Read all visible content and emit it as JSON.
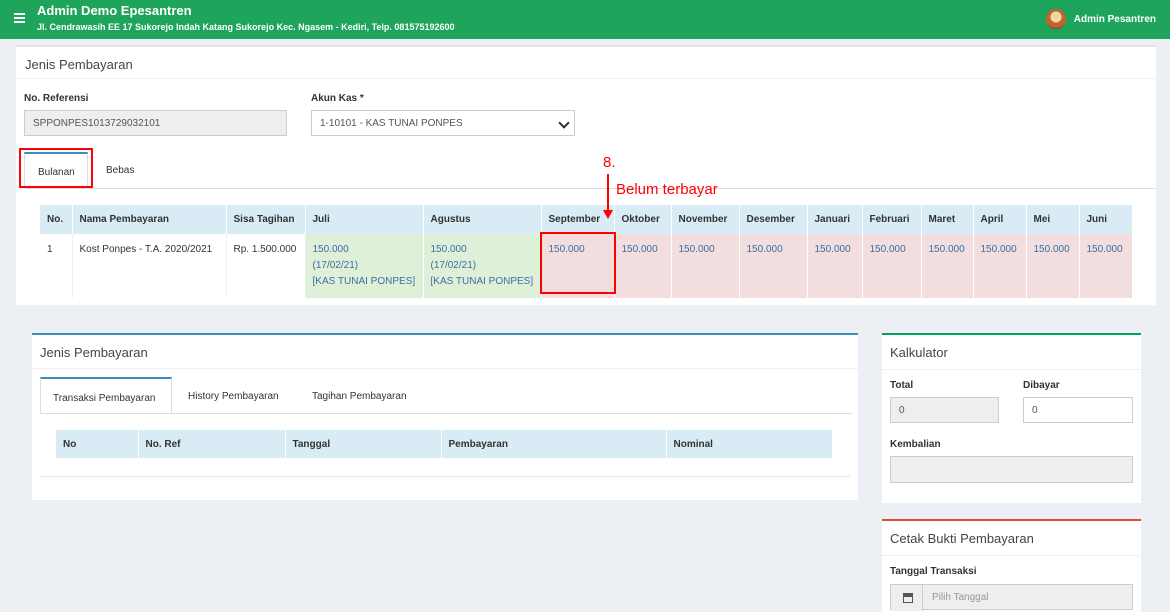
{
  "header": {
    "title": "Admin Demo Epesantren",
    "address": "Jl. Cendrawasih EE 17 Sukorejo Indah Katang Sukorejo Kec. Ngasem - Kediri, Telp. 081575192600",
    "user_name": "Admin Pesantren"
  },
  "main": {
    "title": "Jenis Pembayaran",
    "ref_label": "No. Referensi",
    "ref_value": "SPPONPES1013729032101",
    "akun_label": "Akun Kas *",
    "akun_value": "1-10101 - KAS TUNAI PONPES",
    "tabs": [
      {
        "label": "Bulanan"
      },
      {
        "label": "Bebas"
      }
    ],
    "table": {
      "headers": [
        "No.",
        "Nama Pembayaran",
        "Sisa Tagihan",
        "Juli",
        "Agustus",
        "September",
        "Oktober",
        "November",
        "Desember",
        "Januari",
        "Februari",
        "Maret",
        "April",
        "Mei",
        "Juni"
      ],
      "row": {
        "no": "1",
        "nama": "Kost Ponpes - T.A. 2020/2021",
        "sisa": "Rp. 1.500.000",
        "juli": {
          "amount": "150.000",
          "date": "(17/02/21)",
          "account": "[KAS TUNAI PONPES]"
        },
        "agustus": {
          "amount": "150.000",
          "date": "(17/02/21)",
          "account": "[KAS TUNAI PONPES]"
        },
        "unpaid": [
          "150.000",
          "150.000",
          "150.000",
          "150.000",
          "150.000",
          "150.000",
          "150.000",
          "150.000",
          "150.000",
          "150.000"
        ]
      }
    }
  },
  "annotation": {
    "step": "8.",
    "text": "Belum terbayar"
  },
  "lower": {
    "title": "Jenis Pembayaran",
    "tabs": [
      {
        "label": "Transaksi Pembayaran"
      },
      {
        "label": "History Pembayaran"
      },
      {
        "label": "Tagihan Pembayaran"
      }
    ],
    "table_headers": [
      "No",
      "No. Ref",
      "Tanggal",
      "Pembayaran",
      "Nominal"
    ]
  },
  "kalkulator": {
    "title": "Kalkulator",
    "total_label": "Total",
    "total_value": "0",
    "dibayar_label": "Dibayar",
    "dibayar_value": "0",
    "kembalian_label": "Kembalian",
    "kembalian_value": ""
  },
  "cetak": {
    "title": "Cetak Bukti Pembayaran",
    "tanggal_label": "Tanggal Transaksi",
    "tanggal_placeholder": "Pilih Tanggal"
  },
  "colors": {
    "header_green": "#1fa55b",
    "paid_bg": "#dff0d8",
    "unpaid_bg": "#f2dede",
    "annotation_red": "#ff0000"
  }
}
